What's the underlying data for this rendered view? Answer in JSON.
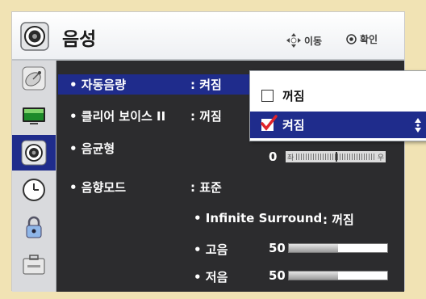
{
  "title": "음성",
  "hints": {
    "move": "이동",
    "confirm": "확인"
  },
  "categories": [
    {
      "icon": "satellite-dish-icon",
      "active": false
    },
    {
      "icon": "monitor-icon",
      "active": false
    },
    {
      "icon": "speaker-icon",
      "active": true
    },
    {
      "icon": "clock-icon",
      "active": false
    },
    {
      "icon": "lock-icon",
      "active": false
    },
    {
      "icon": "toolbox-icon",
      "active": false
    }
  ],
  "menu": {
    "auto_volume": {
      "label": "• 자동음량",
      "value": ": 켜짐"
    },
    "clear_voice": {
      "label": "• 클리어 보이스 II",
      "value": ": 꺼짐"
    },
    "balance": {
      "label": "• 음균형",
      "value": "0",
      "left": "좌",
      "right": "우"
    },
    "sound_mode": {
      "label": "• 음향모드",
      "value": ": 표준"
    },
    "surround": {
      "label": "• Infinite Surround",
      "value": ": 꺼짐"
    },
    "treble": {
      "label": "• 고음",
      "value": "50",
      "level": 50
    },
    "bass": {
      "label": "• 저음",
      "value": "50",
      "level": 50
    }
  },
  "popup": {
    "options": [
      {
        "label": "꺼짐",
        "checked": false
      },
      {
        "label": "켜짐",
        "checked": true
      }
    ]
  },
  "colors": {
    "highlight": "#1f2c8c",
    "content_bg": "#2c2c2e",
    "background": "#f1e3b4"
  }
}
